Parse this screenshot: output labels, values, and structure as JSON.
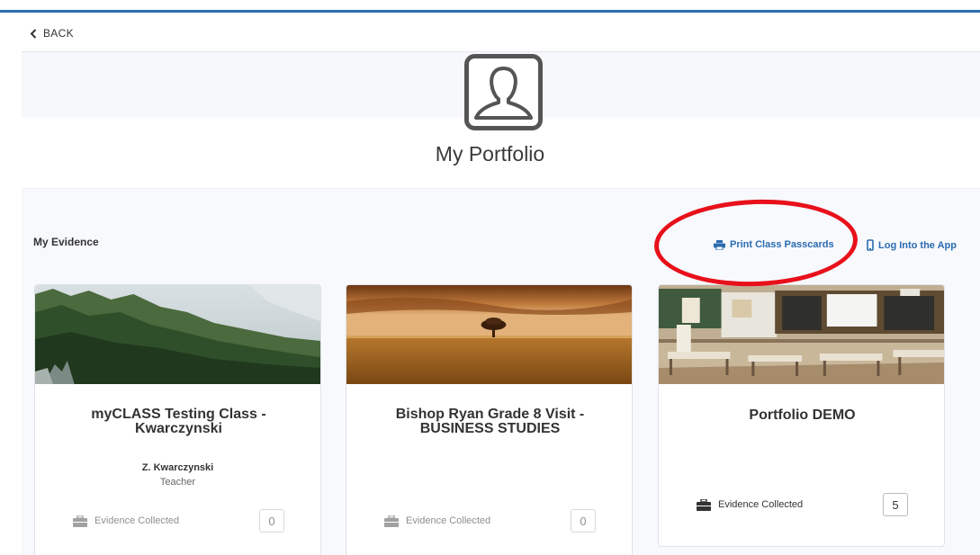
{
  "nav": {
    "back_label": "BACK"
  },
  "header": {
    "title": "My Portfolio",
    "icon": "user-portrait-icon"
  },
  "section": {
    "title": "My Evidence",
    "print_label": "Print Class Passcards",
    "app_label": "Log Into the App"
  },
  "annotation": {
    "highlight_color": "#e8101a"
  },
  "colors": {
    "accent": "#2e6db4",
    "link": "#2a6ab0"
  },
  "cards": [
    {
      "title": "myCLASS Testing Class - Kwarczynski",
      "image": "forest-mountain-photo",
      "teacher_name": "Z. Kwarczynski",
      "teacher_role": "Teacher",
      "evidence_label": "Evidence Collected",
      "evidence_count": "0"
    },
    {
      "title": "Bishop Ryan Grade 8 Visit - BUSINESS STUDIES",
      "image": "wheat-field-tree-photo",
      "evidence_label": "Evidence Collected",
      "evidence_count": "0"
    },
    {
      "title": "Portfolio DEMO",
      "image": "classroom-photo",
      "evidence_label": "Evidence Collected",
      "evidence_count": "5"
    }
  ]
}
